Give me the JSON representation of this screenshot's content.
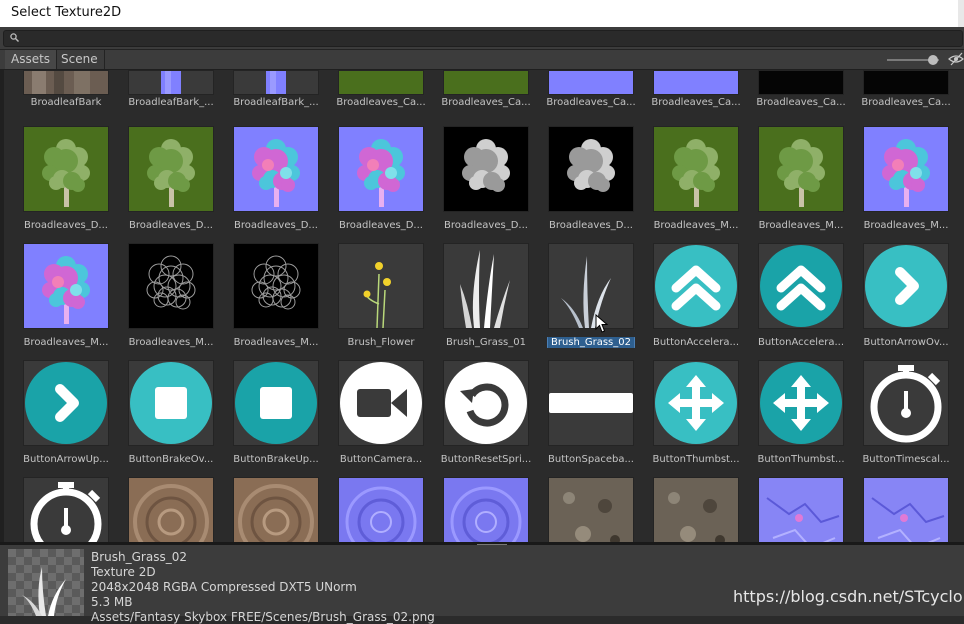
{
  "window": {
    "title": "Select Texture2D"
  },
  "search": {
    "placeholder": ""
  },
  "tabs": [
    {
      "label": "Assets"
    },
    {
      "label": "Scene"
    }
  ],
  "colors": {
    "teal": "#1aa3a8",
    "teal_light": "#38bfc3",
    "normal_map": "#8080ff",
    "foliage_bg": "#4a6f1d",
    "selection": "#2e5f8f"
  },
  "grid": {
    "rows": [
      [
        {
          "label": "BroadleafBark",
          "kind": "bark"
        },
        {
          "label": "BroadleafBark_...",
          "kind": "normal-thin"
        },
        {
          "label": "BroadleafBark_...",
          "kind": "normal-thin"
        },
        {
          "label": "Broadleaves_Ca...",
          "kind": "foliage"
        },
        {
          "label": "Broadleaves_Ca...",
          "kind": "foliage"
        },
        {
          "label": "Broadleaves_Ca...",
          "kind": "normal-foliage"
        },
        {
          "label": "Broadleaves_Ca...",
          "kind": "normal-foliage"
        },
        {
          "label": "Broadleaves_Ca...",
          "kind": "black-mask"
        },
        {
          "label": "Broadleaves_Ca...",
          "kind": "black-mask"
        }
      ],
      [
        {
          "label": "Broadleaves_D...",
          "kind": "tree-green"
        },
        {
          "label": "Broadleaves_D...",
          "kind": "tree-green"
        },
        {
          "label": "Broadleaves_D...",
          "kind": "tree-normal"
        },
        {
          "label": "Broadleaves_D...",
          "kind": "tree-normal"
        },
        {
          "label": "Broadleaves_D...",
          "kind": "tree-mask"
        },
        {
          "label": "Broadleaves_D...",
          "kind": "tree-mask"
        },
        {
          "label": "Broadleaves_M...",
          "kind": "tree-green"
        },
        {
          "label": "Broadleaves_M...",
          "kind": "tree-green"
        },
        {
          "label": "Broadleaves_M...",
          "kind": "tree-normal"
        }
      ],
      [
        {
          "label": "Broadleaves_M...",
          "kind": "tree-normal"
        },
        {
          "label": "Broadleaves_M...",
          "kind": "tree-outline"
        },
        {
          "label": "Broadleaves_M...",
          "kind": "tree-outline"
        },
        {
          "label": "Brush_Flower",
          "kind": "flower"
        },
        {
          "label": "Brush_Grass_01",
          "kind": "grass"
        },
        {
          "label": "Brush_Grass_02",
          "kind": "grass-thin",
          "selected": true
        },
        {
          "label": "ButtonAccelera...",
          "kind": "chevrons-up-light"
        },
        {
          "label": "ButtonAccelera...",
          "kind": "chevrons-up-dark"
        },
        {
          "label": "ButtonArrowOv...",
          "kind": "arrow-right-light"
        }
      ],
      [
        {
          "label": "ButtonArrowUp...",
          "kind": "arrow-right-dark"
        },
        {
          "label": "ButtonBrakeOv...",
          "kind": "stop-light"
        },
        {
          "label": "ButtonBrakeUp...",
          "kind": "stop-dark"
        },
        {
          "label": "ButtonCamera...",
          "kind": "camera"
        },
        {
          "label": "ButtonResetSpri...",
          "kind": "reset"
        },
        {
          "label": "ButtonSpaceba...",
          "kind": "spacebar"
        },
        {
          "label": "ButtonThumbst...",
          "kind": "move-light"
        },
        {
          "label": "ButtonThumbst...",
          "kind": "move-dark"
        },
        {
          "label": "ButtonTimescal...",
          "kind": "stopwatch"
        }
      ],
      [
        {
          "label": "",
          "kind": "stopwatch"
        },
        {
          "label": "",
          "kind": "wood"
        },
        {
          "label": "",
          "kind": "wood"
        },
        {
          "label": "",
          "kind": "normal-rings"
        },
        {
          "label": "",
          "kind": "normal-rings"
        },
        {
          "label": "",
          "kind": "gravel"
        },
        {
          "label": "",
          "kind": "gravel"
        },
        {
          "label": "",
          "kind": "normal-cracks"
        },
        {
          "label": "",
          "kind": "normal-cracks"
        }
      ]
    ]
  },
  "preview": {
    "name": "Brush_Grass_02",
    "type": "Texture 2D",
    "format": "2048x2048  RGBA Compressed DXT5 UNorm",
    "size": "5.3 MB",
    "path": "Assets/Fantasy Skybox FREE/Scenes/Brush_Grass_02.png"
  },
  "watermark": "https://blog.csdn.net/STcyclone"
}
